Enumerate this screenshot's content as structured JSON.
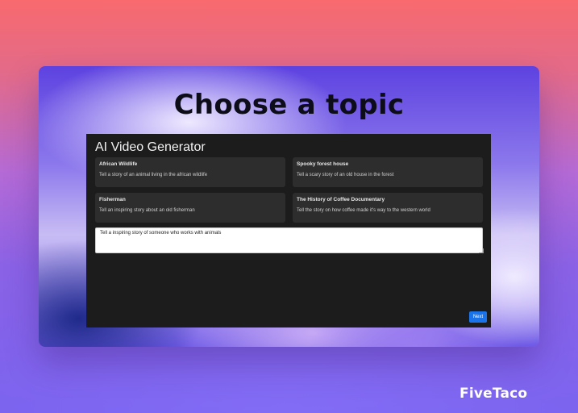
{
  "page": {
    "heading": "Choose a topic",
    "brand": "FiveTaco"
  },
  "app": {
    "title": "AI Video Generator",
    "topics": [
      {
        "title": "African Wildlife",
        "description": "Tell a story of an animal living in the african wildlife"
      },
      {
        "title": "Spooky forest house",
        "description": "Tell a scary story of an old house in the forest"
      },
      {
        "title": "Fisherman",
        "description": "Tell an inspiring story about an old fisherman"
      },
      {
        "title": "The History of Coffee Documentary",
        "description": "Tell the story on how coffee made it's way to the western world"
      }
    ],
    "prompt": {
      "value": "Tell a inspiring story of someone who works with animals"
    },
    "next_label": "Next"
  },
  "colors": {
    "accent": "#1a73e8",
    "panel": "#1c1c1c",
    "tile": "#2d2d2d"
  }
}
